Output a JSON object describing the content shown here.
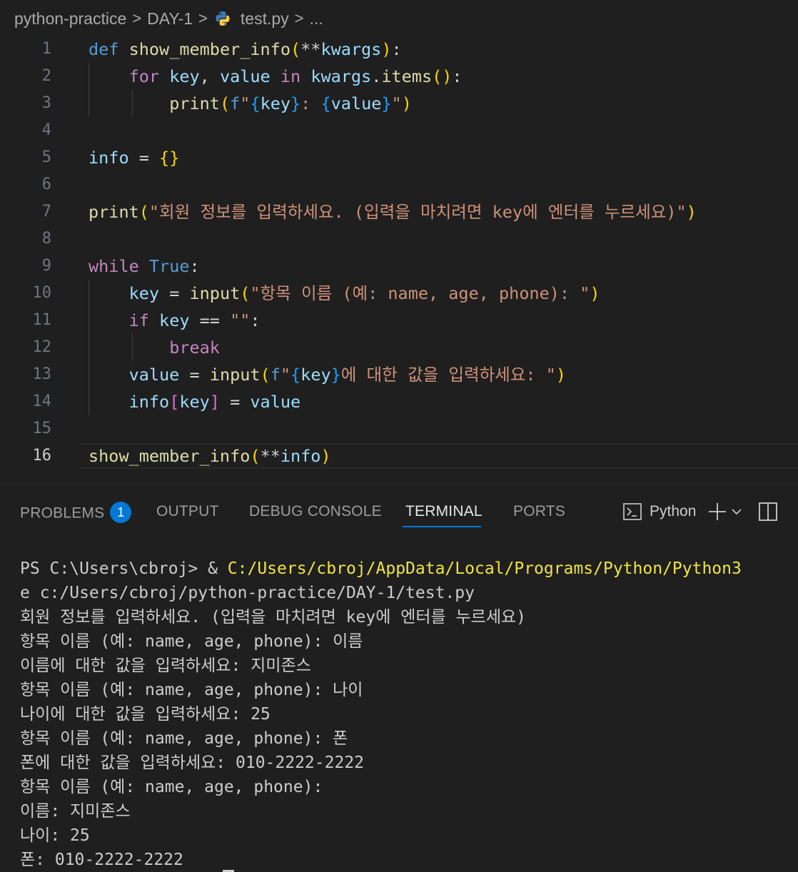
{
  "breadcrumb": {
    "items": [
      "python-practice",
      "DAY-1",
      "test.py",
      "..."
    ],
    "separator": ">"
  },
  "editor": {
    "active_line": 16,
    "line_numbers": [
      "1",
      "2",
      "3",
      "4",
      "5",
      "6",
      "7",
      "8",
      "9",
      "10",
      "11",
      "12",
      "13",
      "14",
      "15",
      "16"
    ],
    "code": {
      "l1_kw": "def",
      "l1_fn": "show_member_info",
      "l1_star": "**",
      "l1_param": "kwargs",
      "l2_for": "for",
      "l2_key": "key",
      "l2_value": "value",
      "l2_in": "in",
      "l2_obj": "kwargs",
      "l2_method": "items",
      "l3_fn": "print",
      "l3_f": "f",
      "l3_key": "key",
      "l3_value": "value",
      "l3_sep": ": ",
      "l5_var": "info",
      "l7_fn": "print",
      "l7_str": "\"회원 정보를 입력하세요. (입력을 마치려면 key에 엔터를 누르세요)\"",
      "l9_while": "while",
      "l9_true": "True",
      "l10_var": "key",
      "l10_fn": "input",
      "l10_str": "\"항목 이름 (예: name, age, phone): \"",
      "l11_if": "if",
      "l11_var": "key",
      "l11_str": "\"\"",
      "l12_break": "break",
      "l13_var": "value",
      "l13_fn": "input",
      "l13_f": "f",
      "l13_key": "key",
      "l13_str_rest": "에 대한 값을 입력하세요: ",
      "l14_obj": "info",
      "l14_key": "key",
      "l14_val": "value",
      "l16_fn": "show_member_info",
      "l16_arg": "info"
    }
  },
  "panel": {
    "tabs": [
      "PROBLEMS",
      "OUTPUT",
      "DEBUG CONSOLE",
      "TERMINAL",
      "PORTS"
    ],
    "active_tab": "TERMINAL",
    "problems_count": "1",
    "terminal_profile": "Python"
  },
  "terminal": {
    "prompt": "PS C:\\Users\\cbroj> & ",
    "python_path": "C:/Users/cbroj/AppData/Local/Programs/Python/Python3",
    "lines": [
      "e c:/Users/cbroj/python-practice/DAY-1/test.py",
      "회원 정보를 입력하세요. (입력을 마치려면 key에 엔터를 누르세요)",
      "항목 이름 (예: name, age, phone): 이름",
      "이름에 대한 값을 입력하세요: 지미존스",
      "항목 이름 (예: name, age, phone): 나이",
      "나이에 대한 값을 입력하세요: 25",
      "항목 이름 (예: name, age, phone): 폰",
      "폰에 대한 값을 입력하세요: 010-2222-2222",
      "항목 이름 (예: name, age, phone):",
      "이름: 지미존스",
      "나이: 25",
      "폰: 010-2222-2222"
    ]
  },
  "colors": {
    "background": "#1f1f1f",
    "accent": "#0078d4",
    "keyword": "#569cd6",
    "control": "#c586c0",
    "function": "#dcdcaa",
    "variable": "#9cdcfe",
    "string": "#ce9178"
  }
}
